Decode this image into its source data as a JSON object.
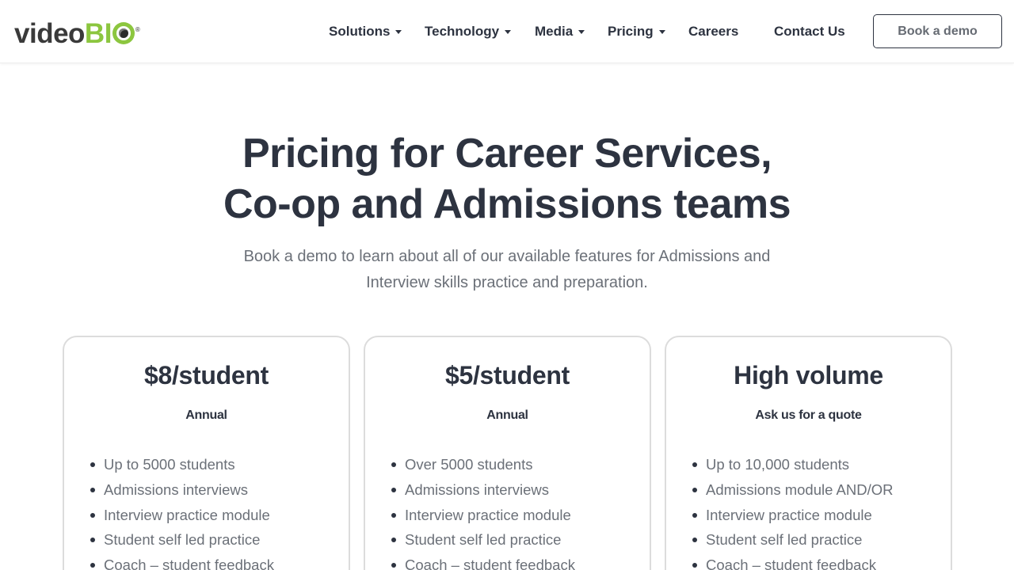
{
  "header": {
    "logo": {
      "part1": "video",
      "part2": "BI",
      "reg": "®"
    },
    "nav": [
      {
        "label": "Solutions",
        "dropdown": true
      },
      {
        "label": "Technology",
        "dropdown": true
      },
      {
        "label": "Media",
        "dropdown": true
      },
      {
        "label": "Pricing",
        "dropdown": true
      },
      {
        "label": "Careers",
        "dropdown": false
      },
      {
        "label": "Contact Us",
        "dropdown": false
      }
    ],
    "cta_label": "Book a demo"
  },
  "hero": {
    "title_line1": "Pricing for Career Services,",
    "title_line2": "Co-op and Admissions teams",
    "subtitle_line1": "Book a demo to learn about all of our available features for Admissions and",
    "subtitle_line2": "Interview skills practice and preparation."
  },
  "plans": [
    {
      "price": "$8/student",
      "period": "Annual",
      "features": [
        "Up to 5000 students",
        "Admissions interviews",
        "Interview practice module",
        "Student self led practice",
        "Coach – student feedback"
      ]
    },
    {
      "price": "$5/student",
      "period": "Annual",
      "features": [
        "Over 5000 students",
        "Admissions interviews",
        "Interview practice module",
        "Student self led practice",
        "Coach – student feedback"
      ]
    },
    {
      "price": "High volume",
      "period": "Ask us for a quote",
      "features": [
        "Up to 10,000 students",
        "Admissions module AND/OR",
        "Interview practice module",
        "Student self led practice",
        "Coach – student feedback"
      ]
    }
  ],
  "colors": {
    "brand_green": "#8cc63f",
    "text_dark": "#2d3340",
    "text_muted": "#6b7078",
    "card_border": "#dcdcdc"
  }
}
